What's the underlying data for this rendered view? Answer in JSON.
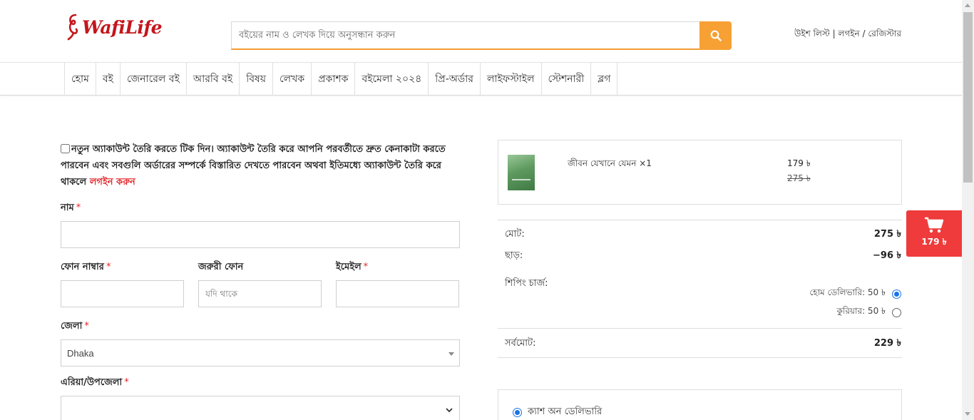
{
  "brand": {
    "name": "WafiLife",
    "color": "#c4161c",
    "accent": "#f7a034"
  },
  "search": {
    "placeholder": "বইয়ের নাম ও লেখক দিয়ে অনুসন্ধান করুন"
  },
  "header_links": {
    "wishlist": "উইশ লিস্ট",
    "sep1": " | ",
    "login": "লগইন",
    "sep2": " / ",
    "register": "রেজিস্টার"
  },
  "nav": {
    "items": [
      "হোম",
      "বই",
      "জেনারেল বই",
      "আরবি বই",
      "বিষয়",
      "লেখক",
      "প্রকাশক",
      "বইমেলা ২০২৪",
      "প্রি-অর্ডার",
      "লাইফস্টাইল",
      "স্টেশনারী",
      "ব্লগ"
    ]
  },
  "account": {
    "text": "নতুন অ্যাকাউন্ট তৈরি করতে টিক দিন। অ্যাকাউন্ট তৈরি করে আপনি পরবর্তীতে দ্রুত কেনাকাটা করতে পারবেন এবং সবগুলি অর্ডারের সম্পর্কে বিস্তারিত দেখতে পারবেন অথবা ইতিমধ্যে অ্যাকাউন্ট তৈরি করে থাকলে",
    "login_link": "লগইন করুন"
  },
  "form": {
    "name_label": "নাম",
    "phone_label": "ফোন নাম্বার",
    "alt_phone_label": "জরুরী ফোন",
    "alt_phone_placeholder": "যদি থাকে",
    "email_label": "ইমেইল",
    "district_label": "জেলা",
    "district_value": "Dhaka",
    "area_label": "এরিয়া/উপজেলা",
    "area_value": "",
    "required_mark": "*"
  },
  "cart": {
    "item": {
      "title": "জীবন যেখানে যেমন",
      "qty": "×1",
      "price": "179 ৳",
      "old_price": "275 ৳"
    }
  },
  "summary": {
    "subtotal_label": "মোট:",
    "subtotal_value": "275 ৳",
    "discount_label": "ছাড়:",
    "discount_value": "−96 ৳",
    "shipping_label": "শিপিং চার্জ:",
    "shipping_options": [
      {
        "label": "হোম ডেলিভারি: 50 ৳",
        "selected": true
      },
      {
        "label": "কুরিয়ার: 50 ৳",
        "selected": false
      }
    ],
    "total_label": "সর্বমোট:",
    "total_value": "229 ৳"
  },
  "payment": {
    "option": "ক্যাশ অন ডেলিভারি",
    "selected": true
  },
  "floating_cart": {
    "total": "179 ৳",
    "color": "#ef3b3b",
    "icon": "cart-icon"
  }
}
